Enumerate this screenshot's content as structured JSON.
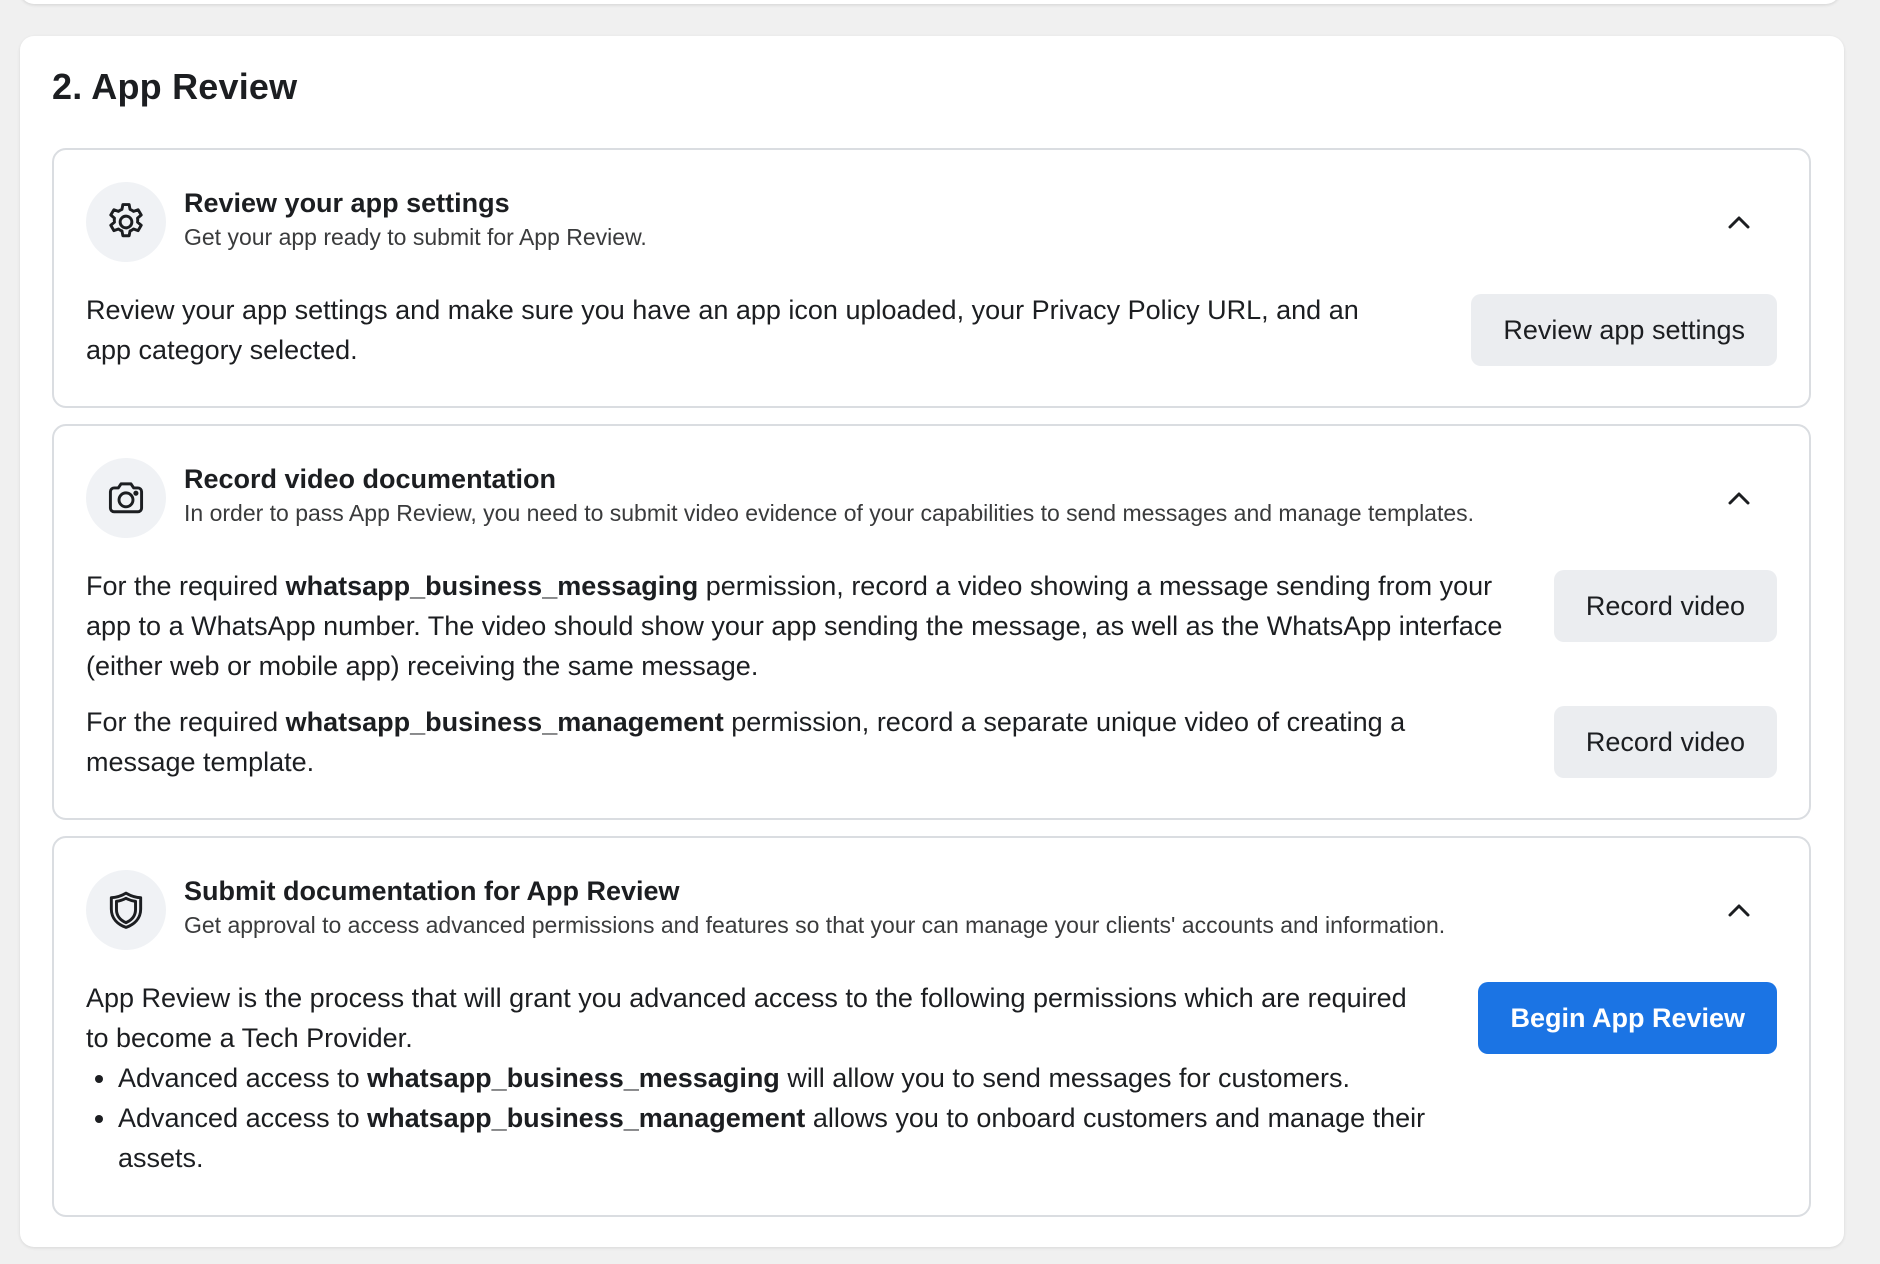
{
  "section": {
    "title": "2. App Review"
  },
  "steps": [
    {
      "icon": "gear-icon",
      "title": "Review your app settings",
      "subtitle": "Get your app ready to submit for App Review.",
      "body": "Review your app settings and make sure you have an app icon uploaded, your Privacy Policy URL, and an app category selected.",
      "button": "Review app settings"
    },
    {
      "icon": "camera-icon",
      "title": "Record video documentation",
      "subtitle": "In order to pass App Review, you need to submit video evidence of your capabilities to send messages and manage templates.",
      "items": [
        {
          "prefix": "For the required ",
          "permission": "whatsapp_business_messaging",
          "suffix": " permission, record a video showing a message sending from your app to a WhatsApp number. The video should show your app sending the message, as well as the WhatsApp interface (either web or mobile app) receiving the same message.",
          "button": "Record video"
        },
        {
          "prefix": "For the required ",
          "permission": "whatsapp_business_management",
          "suffix": " permission, record a separate unique video of creating a message template.",
          "button": "Record video"
        }
      ]
    },
    {
      "icon": "shield-icon",
      "title": "Submit documentation for App Review",
      "subtitle": "Get approval to access advanced permissions and features so that your can manage your clients' accounts and information.",
      "body": "App Review is the process that will grant you advanced access to the following permissions which are required to become a Tech Provider.",
      "bullets": [
        {
          "prefix": "Advanced access to ",
          "permission": "whatsapp_business_messaging",
          "suffix": " will allow you to send messages for customers."
        },
        {
          "prefix": "Advanced access to ",
          "permission": "whatsapp_business_management",
          "suffix": " allows you to onboard customers and manage their assets."
        }
      ],
      "button": "Begin App Review"
    }
  ],
  "colors": {
    "primary": "#1b74e4",
    "secondary_button": "#ebedf0",
    "border": "#dadde1",
    "icon_bg": "#f0f2f5"
  }
}
